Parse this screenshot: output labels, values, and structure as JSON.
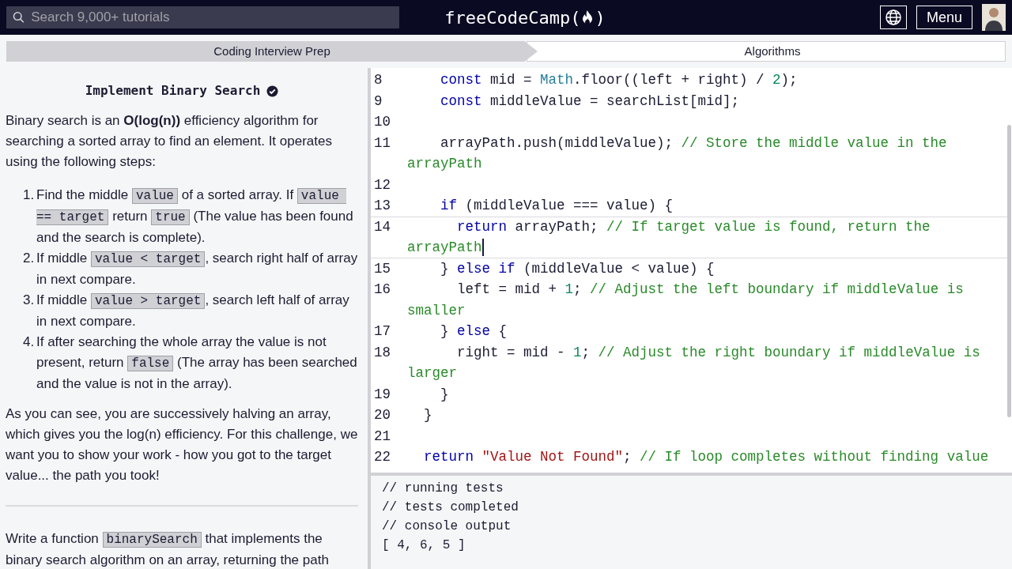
{
  "nav": {
    "search_placeholder": "Search 9,000+ tutorials",
    "logo": "freeCodeCamp(",
    "logo_end": ")",
    "menu": "Menu"
  },
  "breadcrumb": [
    {
      "label": "Coding Interview Prep"
    },
    {
      "label": "Algorithms"
    }
  ],
  "challenge": {
    "title": "Implement Binary Search",
    "completed": true,
    "intro": [
      {
        "kind": "text",
        "t": "Binary search is an **O(log(n))** efficiency algorithm for searching a sorted array to find an element. It operates using the following steps:"
      }
    ],
    "steps": [
      {
        "number": "1.",
        "segments": [
          {
            "kind": "text",
            "t": "Find the middle "
          },
          {
            "kind": "code",
            "t": "value"
          },
          {
            "kind": "text",
            "t": " of a sorted array. If "
          },
          {
            "kind": "code",
            "t": "value == target"
          },
          {
            "kind": "text",
            "t": " return "
          },
          {
            "kind": "code",
            "t": "true"
          },
          {
            "kind": "text",
            "t": " (The value has been found and the search is complete)."
          }
        ]
      },
      {
        "number": "2.",
        "segments": [
          {
            "kind": "text",
            "t": "If middle "
          },
          {
            "kind": "code",
            "t": "value < target"
          },
          {
            "kind": "text",
            "t": ", search right half of array in next compare."
          }
        ]
      },
      {
        "number": "3.",
        "segments": [
          {
            "kind": "text",
            "t": "If middle "
          },
          {
            "kind": "code",
            "t": "value > target"
          },
          {
            "kind": "text",
            "t": ", search left half of array in next compare."
          }
        ]
      },
      {
        "number": "4.",
        "segments": [
          {
            "kind": "text",
            "t": "If after searching the whole array the value is not present, return "
          },
          {
            "kind": "code",
            "t": "false"
          },
          {
            "kind": "text",
            "t": " (The array has been searched and the value is not in the array)."
          }
        ]
      }
    ],
    "outro": [
      {
        "kind": "text",
        "t": "As you can see, you are successively halving an array, which gives you the log(n) efficiency. For this challenge, we want you to show your work - how you got to the target value... the path you took!"
      }
    ],
    "task": [
      {
        "kind": "text",
        "t": "Write a function "
      },
      {
        "kind": "code",
        "t": "binarySearch"
      },
      {
        "kind": "text",
        "t": " that implements the binary search algorithm on an array, returning the path"
      }
    ]
  },
  "editor": {
    "lines": [
      {
        "number": "8",
        "active": false,
        "kind": "medium",
        "tokens": [
          {
            "kind": "keyword",
            "t": "const"
          },
          {
            "kind": "plain",
            "t": " mid = "
          },
          {
            "kind": "builtin",
            "t": "Math"
          },
          {
            "kind": "plain",
            "t": ".floor((left + right) / "
          },
          {
            "kind": "number",
            "t": "2"
          },
          {
            "kind": "plain",
            "t": ");"
          }
        ]
      },
      {
        "number": "9",
        "active": false,
        "kind": "medium",
        "tokens": [
          {
            "kind": "keyword",
            "t": "const"
          },
          {
            "kind": "plain",
            "t": " middleValue = searchList[mid];"
          }
        ]
      },
      {
        "number": "10",
        "active": false
      },
      {
        "number": "11",
        "active": false,
        "kind": "medium",
        "tokens": [
          {
            "kind": "plain",
            "t": "arrayPath.push(middleValue); "
          },
          {
            "kind": "comment",
            "t": "// Store the middle value in the arrayPath"
          }
        ]
      },
      {
        "number": "12",
        "active": false
      },
      {
        "number": "13",
        "active": false,
        "kind": "medium",
        "tokens": [
          {
            "kind": "keyword",
            "t": "if"
          },
          {
            "kind": "plain",
            "t": " (middleValue === value) {"
          }
        ]
      },
      {
        "number": "14",
        "active": true,
        "kind": "deep",
        "tokens": [
          {
            "kind": "keyword",
            "t": "return"
          },
          {
            "kind": "plain",
            "t": " arrayPath; "
          },
          {
            "kind": "comment",
            "t": "// If target value is found, return the arrayPath"
          }
        ]
      },
      {
        "number": "15",
        "active": false,
        "kind": "medium",
        "tokens": [
          {
            "kind": "plain",
            "t": "} "
          },
          {
            "kind": "keyword",
            "t": "else if"
          },
          {
            "kind": "plain",
            "t": " (middleValue < value) {"
          }
        ]
      },
      {
        "number": "16",
        "active": false,
        "kind": "deep",
        "tokens": [
          {
            "kind": "plain",
            "t": "left = mid + "
          },
          {
            "kind": "number",
            "t": "1"
          },
          {
            "kind": "plain",
            "t": "; "
          },
          {
            "kind": "comment",
            "t": "// Adjust the left boundary if middleValue is smaller"
          }
        ]
      },
      {
        "number": "17",
        "active": false,
        "kind": "medium",
        "tokens": [
          {
            "kind": "plain",
            "t": "} "
          },
          {
            "kind": "keyword",
            "t": "else"
          },
          {
            "kind": "plain",
            "t": " {"
          }
        ]
      },
      {
        "number": "18",
        "active": false,
        "kind": "deep",
        "tokens": [
          {
            "kind": "plain",
            "t": "right = mid - "
          },
          {
            "kind": "number",
            "t": "1"
          },
          {
            "kind": "plain",
            "t": "; "
          },
          {
            "kind": "comment",
            "t": "// Adjust the right boundary if middleValue is larger"
          }
        ]
      },
      {
        "number": "19",
        "active": false,
        "kind": "medium",
        "tokens": [
          {
            "kind": "plain",
            "t": "}"
          }
        ]
      },
      {
        "number": "20",
        "active": false,
        "kind": "shallow",
        "tokens": [
          {
            "kind": "plain",
            "t": "}"
          }
        ]
      },
      {
        "number": "21",
        "active": false
      },
      {
        "number": "22",
        "active": false,
        "kind": "shallow",
        "tokens": [
          {
            "kind": "keyword",
            "t": "return "
          },
          {
            "kind": "string",
            "t": "\"Value Not Found\""
          },
          {
            "kind": "plain",
            "t": "; "
          },
          {
            "kind": "comment",
            "t": "// If loop completes without finding value"
          }
        ]
      }
    ]
  },
  "console": [
    "// running tests",
    "// tests completed",
    "// console output",
    "[ 4, 6, 5 ]"
  ]
}
